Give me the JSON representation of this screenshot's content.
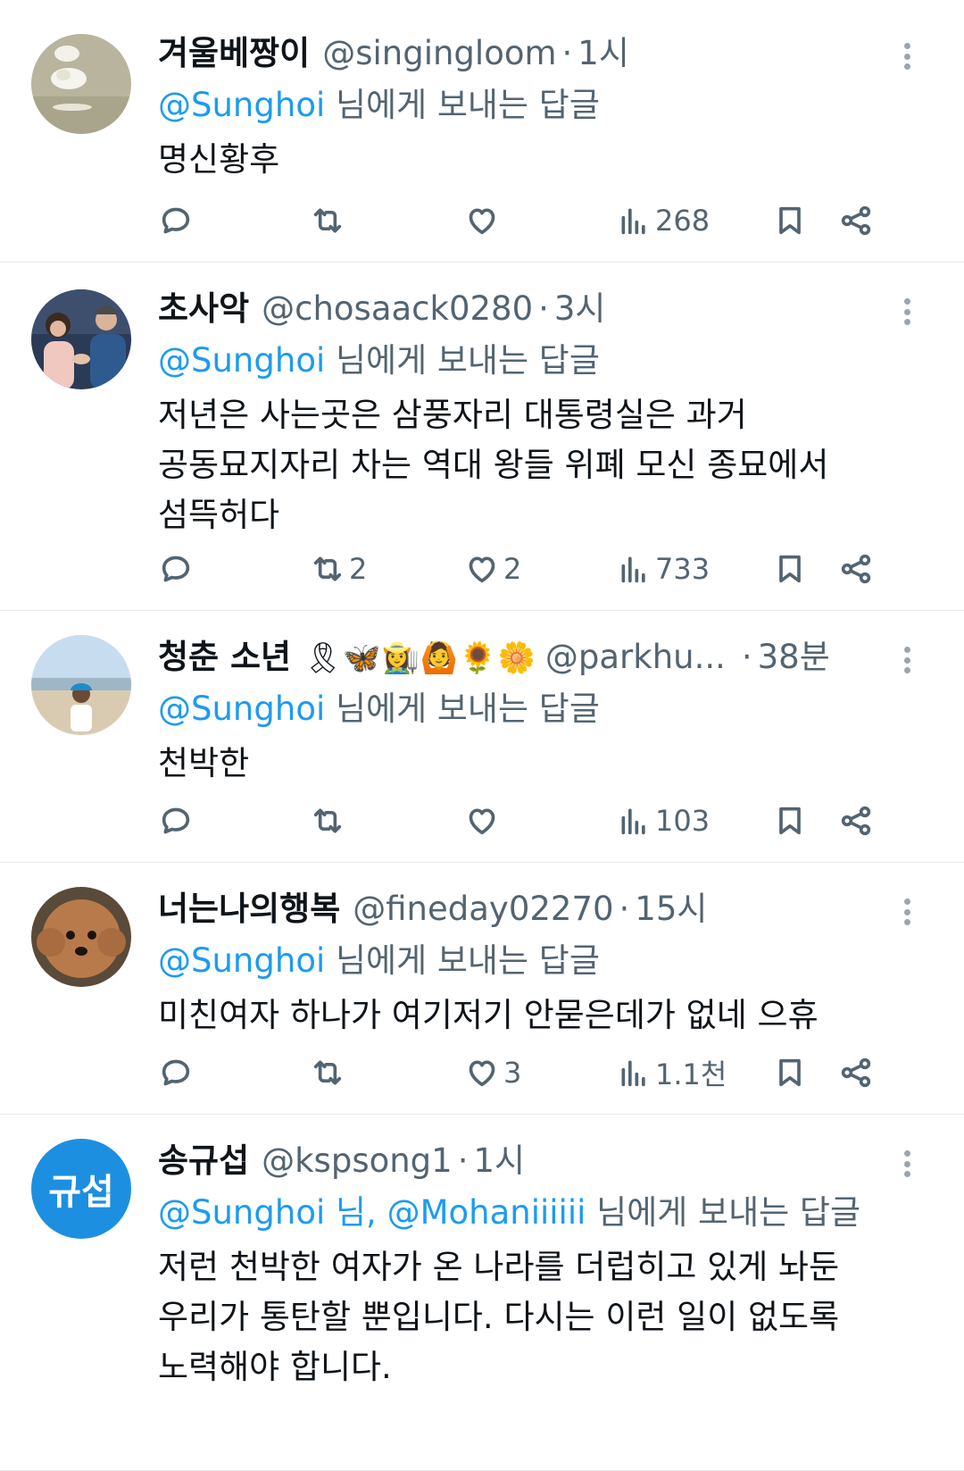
{
  "tweets": [
    {
      "display_name": "겨울베짱이",
      "emojis": "",
      "handle": "@singingloom",
      "separator": "·",
      "time": "1시",
      "reply_prefix": "@Sunghoi",
      "reply_mention_2": "",
      "reply_suffix": " 님에게 보내는 답글",
      "text": "명신황후",
      "replies": "",
      "retweets": "",
      "likes": "",
      "views": "268",
      "avatar_icon": "cotton-photo-avatar"
    },
    {
      "display_name": "초사악",
      "emojis": "",
      "handle": "@chosaack0280",
      "separator": "·",
      "time": "3시",
      "reply_prefix": "@Sunghoi",
      "reply_mention_2": "",
      "reply_suffix": " 님에게 보내는 답글",
      "text": "저년은 사는곳은 삼풍자리 대통령실은 과거\n공동묘지자리 차는 역대 왕들 위폐 모신 종묘에서\n섬뜩허다",
      "replies": "",
      "retweets": "2",
      "likes": "2",
      "views": "733",
      "avatar_icon": "couple-photo-avatar"
    },
    {
      "display_name": "청춘 소년",
      "emojis": "🎗🦋👩‍🌾🙆🌻🌼",
      "handle": "@parkhu...",
      "separator": "·",
      "time": "38분",
      "reply_prefix": "@Sunghoi",
      "reply_mention_2": "",
      "reply_suffix": " 님에게 보내는 답글",
      "text": "천박한",
      "replies": "",
      "retweets": "",
      "likes": "",
      "views": "103",
      "avatar_icon": "beach-photo-avatar"
    },
    {
      "display_name": "너는나의행복",
      "emojis": "",
      "handle": "@fineday02270",
      "separator": "·",
      "time": "15시",
      "reply_prefix": "@Sunghoi",
      "reply_mention_2": "",
      "reply_suffix": " 님에게 보내는 답글",
      "text": "미친여자 하나가 여기저기 안묻은데가 없네 으휴",
      "replies": "",
      "retweets": "",
      "likes": "3",
      "views": "1.1천",
      "avatar_icon": "dog-photo-avatar"
    },
    {
      "display_name": "송규섭",
      "emojis": "",
      "handle": "@kspsong1",
      "separator": "·",
      "time": "1시",
      "reply_prefix": "@Sunghoi 님, ",
      "reply_mention_2": "@Mohaniiiiii",
      "reply_suffix": " 님에게 보내는 답글",
      "text": "저런 천박한 여자가 온 나라를 더럽히고 있게 놔둔\n우리가 통탄할 뿐입니다. 다시는 이런 일이 없도록\n노력해야 합니다.",
      "avatar_text": "규섭"
    }
  ],
  "colors": {
    "accent": "#1d9bf0",
    "secondary_text": "#536471",
    "divider": "#e6e9eb"
  }
}
